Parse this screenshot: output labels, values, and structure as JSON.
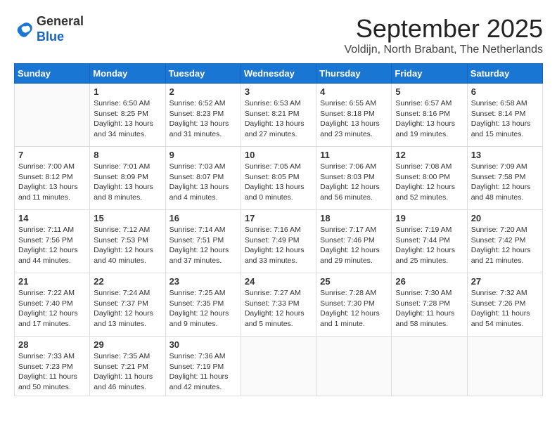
{
  "header": {
    "logo_general": "General",
    "logo_blue": "Blue",
    "month_title": "September 2025",
    "location": "Voldijn, North Brabant, The Netherlands"
  },
  "days_of_week": [
    "Sunday",
    "Monday",
    "Tuesday",
    "Wednesday",
    "Thursday",
    "Friday",
    "Saturday"
  ],
  "weeks": [
    [
      {
        "day": "",
        "content": ""
      },
      {
        "day": "1",
        "content": "Sunrise: 6:50 AM\nSunset: 8:25 PM\nDaylight: 13 hours\nand 34 minutes."
      },
      {
        "day": "2",
        "content": "Sunrise: 6:52 AM\nSunset: 8:23 PM\nDaylight: 13 hours\nand 31 minutes."
      },
      {
        "day": "3",
        "content": "Sunrise: 6:53 AM\nSunset: 8:21 PM\nDaylight: 13 hours\nand 27 minutes."
      },
      {
        "day": "4",
        "content": "Sunrise: 6:55 AM\nSunset: 8:18 PM\nDaylight: 13 hours\nand 23 minutes."
      },
      {
        "day": "5",
        "content": "Sunrise: 6:57 AM\nSunset: 8:16 PM\nDaylight: 13 hours\nand 19 minutes."
      },
      {
        "day": "6",
        "content": "Sunrise: 6:58 AM\nSunset: 8:14 PM\nDaylight: 13 hours\nand 15 minutes."
      }
    ],
    [
      {
        "day": "7",
        "content": "Sunrise: 7:00 AM\nSunset: 8:12 PM\nDaylight: 13 hours\nand 11 minutes."
      },
      {
        "day": "8",
        "content": "Sunrise: 7:01 AM\nSunset: 8:09 PM\nDaylight: 13 hours\nand 8 minutes."
      },
      {
        "day": "9",
        "content": "Sunrise: 7:03 AM\nSunset: 8:07 PM\nDaylight: 13 hours\nand 4 minutes."
      },
      {
        "day": "10",
        "content": "Sunrise: 7:05 AM\nSunset: 8:05 PM\nDaylight: 13 hours\nand 0 minutes."
      },
      {
        "day": "11",
        "content": "Sunrise: 7:06 AM\nSunset: 8:03 PM\nDaylight: 12 hours\nand 56 minutes."
      },
      {
        "day": "12",
        "content": "Sunrise: 7:08 AM\nSunset: 8:00 PM\nDaylight: 12 hours\nand 52 minutes."
      },
      {
        "day": "13",
        "content": "Sunrise: 7:09 AM\nSunset: 7:58 PM\nDaylight: 12 hours\nand 48 minutes."
      }
    ],
    [
      {
        "day": "14",
        "content": "Sunrise: 7:11 AM\nSunset: 7:56 PM\nDaylight: 12 hours\nand 44 minutes."
      },
      {
        "day": "15",
        "content": "Sunrise: 7:12 AM\nSunset: 7:53 PM\nDaylight: 12 hours\nand 40 minutes."
      },
      {
        "day": "16",
        "content": "Sunrise: 7:14 AM\nSunset: 7:51 PM\nDaylight: 12 hours\nand 37 minutes."
      },
      {
        "day": "17",
        "content": "Sunrise: 7:16 AM\nSunset: 7:49 PM\nDaylight: 12 hours\nand 33 minutes."
      },
      {
        "day": "18",
        "content": "Sunrise: 7:17 AM\nSunset: 7:46 PM\nDaylight: 12 hours\nand 29 minutes."
      },
      {
        "day": "19",
        "content": "Sunrise: 7:19 AM\nSunset: 7:44 PM\nDaylight: 12 hours\nand 25 minutes."
      },
      {
        "day": "20",
        "content": "Sunrise: 7:20 AM\nSunset: 7:42 PM\nDaylight: 12 hours\nand 21 minutes."
      }
    ],
    [
      {
        "day": "21",
        "content": "Sunrise: 7:22 AM\nSunset: 7:40 PM\nDaylight: 12 hours\nand 17 minutes."
      },
      {
        "day": "22",
        "content": "Sunrise: 7:24 AM\nSunset: 7:37 PM\nDaylight: 12 hours\nand 13 minutes."
      },
      {
        "day": "23",
        "content": "Sunrise: 7:25 AM\nSunset: 7:35 PM\nDaylight: 12 hours\nand 9 minutes."
      },
      {
        "day": "24",
        "content": "Sunrise: 7:27 AM\nSunset: 7:33 PM\nDaylight: 12 hours\nand 5 minutes."
      },
      {
        "day": "25",
        "content": "Sunrise: 7:28 AM\nSunset: 7:30 PM\nDaylight: 12 hours\nand 1 minute."
      },
      {
        "day": "26",
        "content": "Sunrise: 7:30 AM\nSunset: 7:28 PM\nDaylight: 11 hours\nand 58 minutes."
      },
      {
        "day": "27",
        "content": "Sunrise: 7:32 AM\nSunset: 7:26 PM\nDaylight: 11 hours\nand 54 minutes."
      }
    ],
    [
      {
        "day": "28",
        "content": "Sunrise: 7:33 AM\nSunset: 7:23 PM\nDaylight: 11 hours\nand 50 minutes."
      },
      {
        "day": "29",
        "content": "Sunrise: 7:35 AM\nSunset: 7:21 PM\nDaylight: 11 hours\nand 46 minutes."
      },
      {
        "day": "30",
        "content": "Sunrise: 7:36 AM\nSunset: 7:19 PM\nDaylight: 11 hours\nand 42 minutes."
      },
      {
        "day": "",
        "content": ""
      },
      {
        "day": "",
        "content": ""
      },
      {
        "day": "",
        "content": ""
      },
      {
        "day": "",
        "content": ""
      }
    ]
  ]
}
